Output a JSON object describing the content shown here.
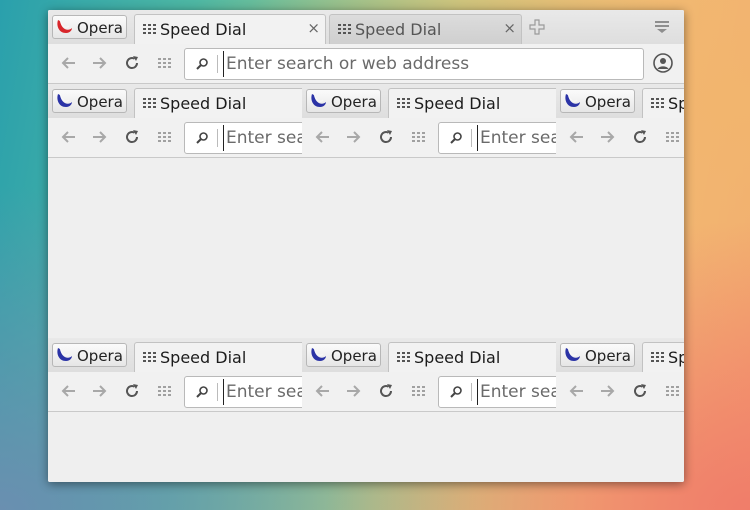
{
  "browser": {
    "opera_label": "Opera",
    "tabs": [
      {
        "label": "Speed Dial",
        "active": true
      },
      {
        "label": "Speed Dial",
        "active": false
      }
    ],
    "close_glyph": "×",
    "address_placeholder": "Enter search or web address"
  },
  "icons": {
    "back": "arrow-left-icon",
    "forward": "arrow-right-icon",
    "reload": "reload-icon",
    "speed_dial": "grid-icon",
    "search": "search-icon",
    "new_tab": "plus-icon",
    "tab_menu": "tab-menu-icon",
    "profile": "user-icon"
  },
  "colors": {
    "opera_red": "#d8262b",
    "opera_blue": "#2b33a6"
  }
}
